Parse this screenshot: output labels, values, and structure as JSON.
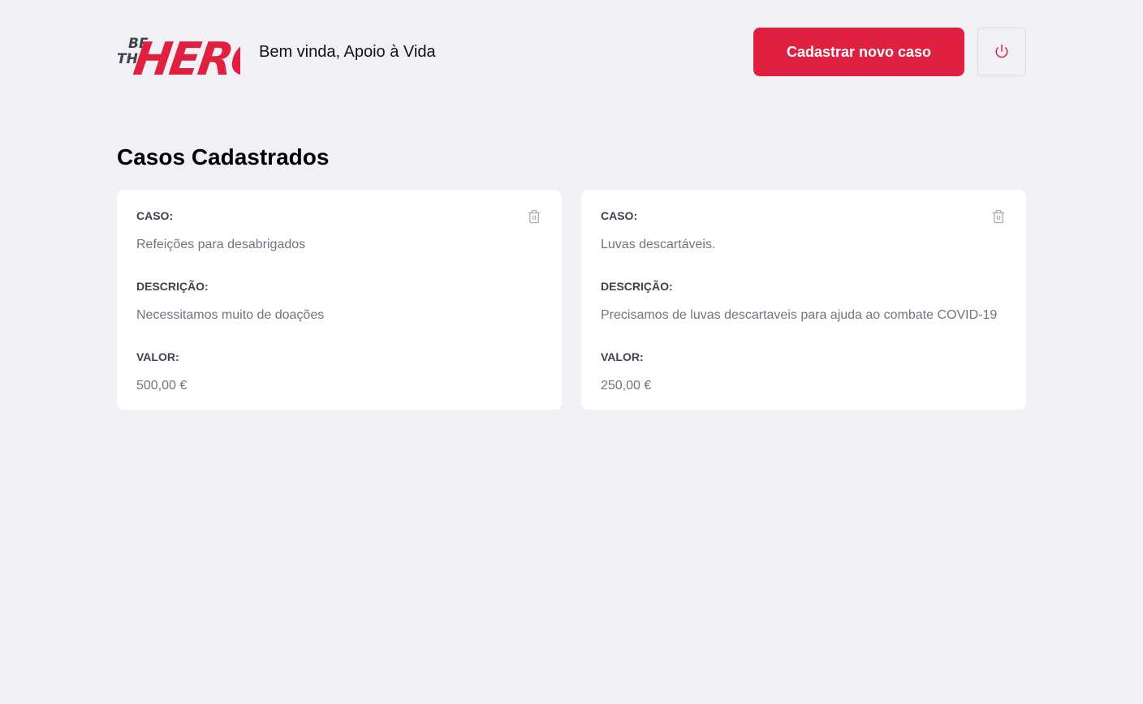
{
  "header": {
    "logo_text_small": "BE THE",
    "logo_text_big": "HERO",
    "greeting": "Bem vinda, Apoio à Vida",
    "new_case_label": "Cadastrar novo caso",
    "logout_icon": "power-icon"
  },
  "main": {
    "title": "Casos Cadastrados",
    "cases": [
      {
        "case_label": "CASO:",
        "case_value": "Refeições para desabrigados",
        "description_label": "DESCRIÇÃO:",
        "description_value": "Necessitamos muito de doações",
        "value_label": "VALOR:",
        "value_value": "500,00 €",
        "delete_icon": "trash-icon"
      },
      {
        "case_label": "CASO:",
        "case_value": "Luvas descartáveis.",
        "description_label": "DESCRIÇÃO:",
        "description_value": "Precisamos de luvas descartaveis para ajuda ao combate COVID-19",
        "value_label": "VALOR:",
        "value_value": "250,00 €",
        "delete_icon": "trash-icon"
      }
    ]
  },
  "colors": {
    "brand": "#e02041",
    "background": "#f0f0f5",
    "logo_dark": "#41414d"
  }
}
